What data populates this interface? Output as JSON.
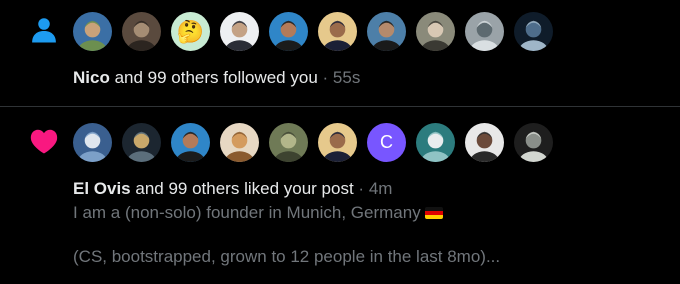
{
  "colors": {
    "background": "#000000",
    "text_primary": "#e7e9ea",
    "text_secondary": "#71767b",
    "follow_icon": "#1d9bf0",
    "like_icon": "#f91880",
    "divider": "#2f3336"
  },
  "notifications": [
    {
      "type": "follow",
      "icon": "person-icon",
      "actor": "Nico",
      "rest": "and 99 others followed you",
      "separator": "·",
      "time": "55s",
      "avatars": [
        {
          "kind": "photo",
          "palette": [
            "#3b6fa5",
            "#c9a27a",
            "#6c8f4f"
          ]
        },
        {
          "kind": "photo",
          "palette": [
            "#5a4a3e",
            "#a58d74",
            "#2c2520"
          ]
        },
        {
          "kind": "emoji",
          "glyph": "🤔",
          "bg": "#c8ebd3"
        },
        {
          "kind": "photo",
          "palette": [
            "#eef0f2",
            "#c4a285",
            "#2a2d36"
          ]
        },
        {
          "kind": "photo",
          "palette": [
            "#2f86c8",
            "#b37b5a",
            "#1b1b1b"
          ]
        },
        {
          "kind": "photo",
          "palette": [
            "#e6c98c",
            "#9a6b4b",
            "#1b2036"
          ]
        },
        {
          "kind": "photo",
          "palette": [
            "#4d7fa8",
            "#b58a6c",
            "#1a1a1a"
          ]
        },
        {
          "kind": "photo",
          "palette": [
            "#8a8a7a",
            "#d8c8b4",
            "#3b3a33"
          ]
        },
        {
          "kind": "photo",
          "palette": [
            "#9aa3a8",
            "#5d6a70",
            "#d9dfe2"
          ]
        },
        {
          "kind": "photo",
          "palette": [
            "#0f1c2a",
            "#4e6d8b",
            "#9fb6c8"
          ]
        }
      ]
    },
    {
      "type": "like",
      "icon": "heart-icon",
      "actor": "El Ovis",
      "rest": "and 99 others liked your post",
      "separator": "·",
      "time": "4m",
      "preview_line1": "I am a (non-solo) founder in Munich, Germany",
      "preview_line2": "(CS, bootstrapped, grown to 12 people in the last 8mo)...",
      "avatars": [
        {
          "kind": "photo",
          "palette": [
            "#3a5f8f",
            "#dfe6ee",
            "#7ca0c8"
          ]
        },
        {
          "kind": "photo",
          "palette": [
            "#1c2630",
            "#c9a86a",
            "#5b6e7b"
          ]
        },
        {
          "kind": "photo",
          "palette": [
            "#2f86c8",
            "#b37b5a",
            "#1b1b1b"
          ]
        },
        {
          "kind": "photo",
          "palette": [
            "#e7d8c3",
            "#d49b5e",
            "#8a5a2e"
          ]
        },
        {
          "kind": "photo",
          "palette": [
            "#6f7a56",
            "#b2b68a",
            "#3d4330"
          ]
        },
        {
          "kind": "photo",
          "palette": [
            "#e6c98c",
            "#9a6b4b",
            "#1b2036"
          ]
        },
        {
          "kind": "letter",
          "glyph": "C",
          "bg": "#7856ff"
        },
        {
          "kind": "photo",
          "palette": [
            "#2c7c7e",
            "#e9ecee",
            "#8fc3c4"
          ]
        },
        {
          "kind": "photo",
          "palette": [
            "#e8e8e8",
            "#6b4a3a",
            "#2a2a2a"
          ]
        },
        {
          "kind": "photo",
          "palette": [
            "#1e1e1e",
            "#8a8f8a",
            "#d2d6d0"
          ]
        }
      ]
    }
  ]
}
